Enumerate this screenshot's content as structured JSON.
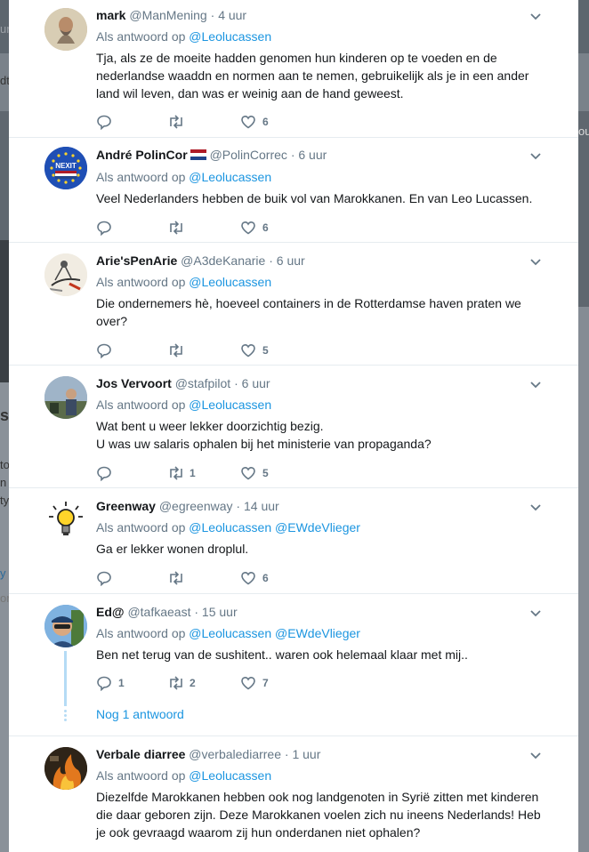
{
  "background": {
    "left_fragments": [
      "ur",
      "dt",
      "s",
      "to",
      "n",
      "ty",
      "y",
      "or"
    ],
    "right_fragments": [
      "ou"
    ]
  },
  "tweets": [
    {
      "name": "mark",
      "handle": "@ManMening",
      "time": "4 uur",
      "reply_prefix": "Als antwoord op",
      "mentions": [
        "@Leolucassen"
      ],
      "text": "Tja, als ze de moeite hadden genomen hun kinderen op te voeden en de nederlandse waaddn en normen aan te nemen, gebruikelijk als je in een ander land wil leven, dan was er weinig aan de hand geweest.",
      "replies": "",
      "retweets": "",
      "likes": "6",
      "avatar_icon": "bearded-man-avatar"
    },
    {
      "name": "André PolinCor",
      "handle": "@PolinCorrec",
      "time": "6 uur",
      "reply_prefix": "Als antwoord op",
      "mentions": [
        "@Leolucassen"
      ],
      "text": "Veel Nederlanders hebben de buik vol van Marokkanen. En van Leo Lucassen.",
      "replies": "",
      "retweets": "",
      "likes": "6",
      "avatar_icon": "nexit-avatar",
      "avatar_text": "NEXIT",
      "flag_icon": "netherlands-flag-icon"
    },
    {
      "name": "Arie'sPenArie",
      "handle": "@A3deKanarie",
      "time": "6 uur",
      "reply_prefix": "Als antwoord op",
      "mentions": [
        "@Leolucassen"
      ],
      "text": "Die ondernemers hè, hoeveel containers in de Rotterdamse haven praten we over?",
      "replies": "",
      "retweets": "",
      "likes": "5",
      "avatar_icon": "sketch-avatar"
    },
    {
      "name": "Jos Vervoort",
      "handle": "@stafpilot",
      "time": "6 uur",
      "reply_prefix": "Als antwoord op",
      "mentions": [
        "@Leolucassen"
      ],
      "text_lines": [
        "Wat bent u weer lekker doorzichtig bezig.",
        "U was uw salaris ophalen bij het ministerie van propaganda?"
      ],
      "replies": "",
      "retweets": "1",
      "likes": "5",
      "avatar_icon": "outdoor-photo-avatar"
    },
    {
      "name": "Greenway",
      "handle": "@egreenway",
      "time": "14 uur",
      "reply_prefix": "Als antwoord op",
      "mentions": [
        "@Leolucassen",
        "@EWdeVlieger"
      ],
      "text": "Ga er lekker wonen droplul.",
      "replies": "",
      "retweets": "",
      "likes": "6",
      "avatar_icon": "lightbulb-avatar"
    },
    {
      "name": "Ed@",
      "handle": "@tafkaeast",
      "time": "15 uur",
      "reply_prefix": "Als antwoord op",
      "mentions": [
        "@Leolucassen",
        "@EWdeVlieger"
      ],
      "text": "Ben net terug van de sushitent.. waren ook helemaal klaar met mij..",
      "replies": "1",
      "retweets": "2",
      "likes": "7",
      "avatar_icon": "man-with-cap-avatar",
      "more_link": "Nog 1 antwoord"
    },
    {
      "name": "Verbale diarree",
      "handle": "@verbalediarree",
      "time": "1 uur",
      "reply_prefix": "Als antwoord op",
      "mentions": [
        "@Leolucassen"
      ],
      "text": "Diezelfde Marokkanen hebben ook nog landgenoten in Syrië zitten met kinderen die daar geboren zijn. Deze Marokkanen voelen zich nu ineens Nederlands! Heb je ook gevraagd waarom zij hun onderdanen niet ophalen?",
      "avatar_icon": "fire-avatar"
    }
  ],
  "colors": {
    "link": "#1b95e0",
    "secondary": "#657786",
    "text": "#14171a",
    "thread": "#b5dbf5",
    "heart": "#657786"
  }
}
